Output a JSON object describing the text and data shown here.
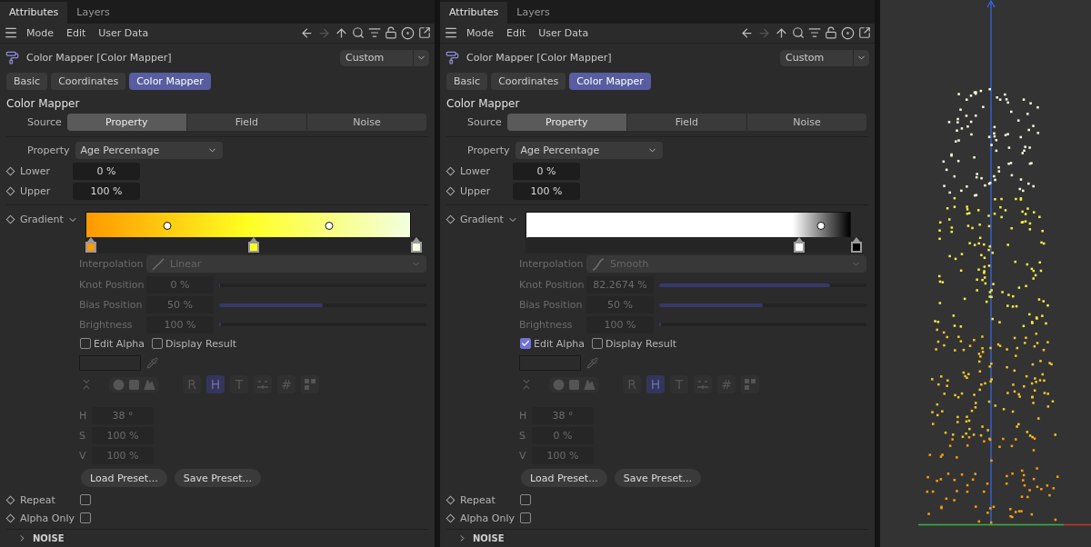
{
  "panels": [
    {
      "tabs": [
        {
          "label": "Attributes",
          "selected": true
        },
        {
          "label": "Layers",
          "selected": false
        }
      ],
      "menu": [
        "Mode",
        "Edit",
        "User Data"
      ],
      "object_title": "Color Mapper [Color Mapper]",
      "preset": "Custom",
      "param_tabs": [
        {
          "label": "Basic",
          "selected": false
        },
        {
          "label": "Coordinates",
          "selected": false
        },
        {
          "label": "Color Mapper",
          "selected": true
        }
      ],
      "section": "Color Mapper",
      "source": {
        "label": "Source",
        "options": [
          {
            "label": "Property",
            "selected": true
          },
          {
            "label": "Field",
            "selected": false
          },
          {
            "label": "Noise",
            "selected": false
          }
        ]
      },
      "property": {
        "label": "Property",
        "value": "Age Percentage"
      },
      "lower": {
        "label": "Lower",
        "value": "0 %"
      },
      "upper": {
        "label": "Upper",
        "value": "100 %"
      },
      "gradient": {
        "label": "Gradient",
        "knots": [
          {
            "level": 0,
            "color": "#ff9900"
          },
          {
            "level": 0.5,
            "color": "#ffff22"
          },
          {
            "level": 1,
            "color": "#f4ffe0"
          }
        ]
      },
      "interpolation": {
        "label": "Interpolation",
        "value": "Linear",
        "kind": "linear"
      },
      "sliders": [
        {
          "label": "Knot Position",
          "value": "0 %",
          "level": 0
        },
        {
          "label": "Bias Position",
          "value": "50 %",
          "level": 0.5
        },
        {
          "label": "Brightness",
          "value": "100 %",
          "level": 0.01
        }
      ],
      "checks": [
        {
          "label": "Edit Alpha",
          "checked": false
        },
        {
          "label": "Display Result",
          "checked": false
        }
      ],
      "modes": [
        {
          "kind": "letter",
          "label": "R",
          "selected": false
        },
        {
          "kind": "letter",
          "label": "H",
          "selected": true
        },
        {
          "kind": "letter",
          "label": "T",
          "selected": false
        },
        {
          "kind": "sliders",
          "selected": false
        },
        {
          "kind": "letter",
          "label": "#",
          "selected": false
        },
        {
          "kind": "swatches",
          "selected": false
        }
      ],
      "hsv": [
        {
          "label": "H",
          "value": "38 °"
        },
        {
          "label": "S",
          "value": "100 %"
        },
        {
          "label": "V",
          "value": "100 %"
        }
      ],
      "buttons": [
        "Load Preset...",
        "Save Preset..."
      ],
      "options": [
        {
          "label": "Repeat",
          "checked": false
        },
        {
          "label": "Alpha Only",
          "checked": false
        }
      ],
      "group": {
        "label": "NOISE",
        "expanded": false
      }
    },
    {
      "tabs": [
        {
          "label": "Attributes",
          "selected": true
        },
        {
          "label": "Layers",
          "selected": false
        }
      ],
      "menu": [
        "Mode",
        "Edit",
        "User Data"
      ],
      "object_title": "Color Mapper [Color Mapper]",
      "preset": "Custom",
      "param_tabs": [
        {
          "label": "Basic",
          "selected": false
        },
        {
          "label": "Coordinates",
          "selected": false
        },
        {
          "label": "Color Mapper",
          "selected": true
        }
      ],
      "section": "Color Mapper",
      "source": {
        "label": "Source",
        "options": [
          {
            "label": "Property",
            "selected": true
          },
          {
            "label": "Field",
            "selected": false
          },
          {
            "label": "Noise",
            "selected": false
          }
        ]
      },
      "property": {
        "label": "Property",
        "value": "Age Percentage"
      },
      "lower": {
        "label": "Lower",
        "value": "0 %"
      },
      "upper": {
        "label": "Upper",
        "value": "100 %"
      },
      "gradient": {
        "label": "Gradient",
        "knots": [
          {
            "level": 0.822674,
            "color": "#ffffff"
          },
          {
            "level": 1,
            "color": "#000000"
          }
        ]
      },
      "interpolation": {
        "label": "Interpolation",
        "value": "Smooth",
        "kind": "smooth"
      },
      "sliders": [
        {
          "label": "Knot Position",
          "value": "82.2674 %",
          "level": 0.822674
        },
        {
          "label": "Bias Position",
          "value": "50 %",
          "level": 0.5
        },
        {
          "label": "Brightness",
          "value": "100 %",
          "level": 0.01
        }
      ],
      "checks": [
        {
          "label": "Edit Alpha",
          "checked": true
        },
        {
          "label": "Display Result",
          "checked": false
        }
      ],
      "modes": [
        {
          "kind": "letter",
          "label": "R",
          "selected": false
        },
        {
          "kind": "letter",
          "label": "H",
          "selected": true
        },
        {
          "kind": "letter",
          "label": "T",
          "selected": false
        },
        {
          "kind": "sliders",
          "selected": false
        },
        {
          "kind": "letter",
          "label": "#",
          "selected": false
        },
        {
          "kind": "swatches",
          "selected": false
        }
      ],
      "hsv": [
        {
          "label": "H",
          "value": "38 °"
        },
        {
          "label": "S",
          "value": "0 %"
        },
        {
          "label": "V",
          "value": "100 %"
        }
      ],
      "buttons": [
        "Load Preset...",
        "Save Preset..."
      ],
      "options": [
        {
          "label": "Repeat",
          "checked": false
        },
        {
          "label": "Alpha Only",
          "checked": false
        }
      ],
      "group": {
        "label": "NOISE",
        "expanded": false
      }
    }
  ]
}
